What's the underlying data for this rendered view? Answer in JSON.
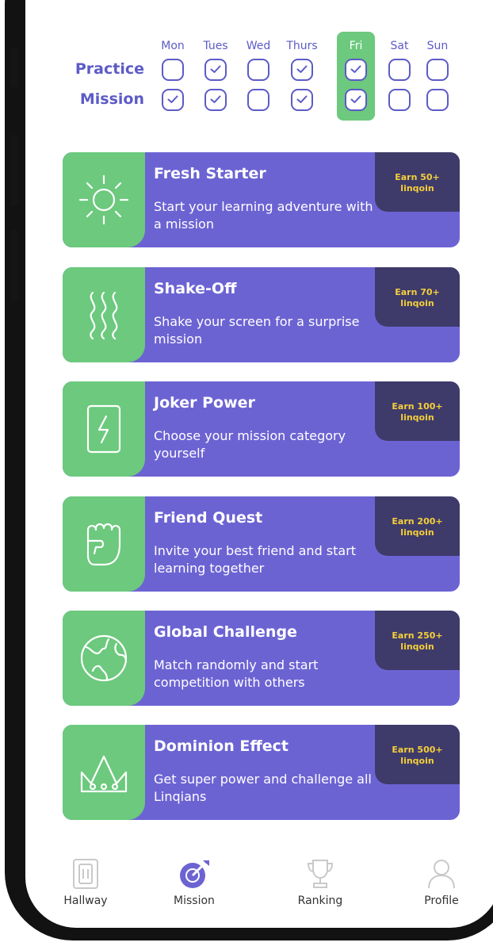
{
  "tracker": {
    "days": [
      "Mon",
      "Tues",
      "Wed",
      "Thurs",
      "Fri",
      "Sat",
      "Sun"
    ],
    "current_day": "Fri",
    "rows": [
      {
        "label": "Practice",
        "checked": [
          false,
          true,
          false,
          true,
          true,
          false,
          false
        ]
      },
      {
        "label": "Mission",
        "checked": [
          true,
          true,
          false,
          true,
          true,
          false,
          false
        ]
      }
    ]
  },
  "missions": [
    {
      "icon": "sun-icon",
      "title": "Fresh Starter",
      "description": "Start your learning adventure with a mission",
      "reward_line1": "Earn 50+",
      "reward_line2": "linqoin"
    },
    {
      "icon": "shake-waves-icon",
      "title": "Shake-Off",
      "description": "Shake your screen for a surprise mission",
      "reward_line1": "Earn 70+",
      "reward_line2": "linqoin"
    },
    {
      "icon": "joker-card-icon",
      "title": "Joker Power",
      "description": "Choose your mission category yourself",
      "reward_line1": "Earn 100+",
      "reward_line2": "linqoin"
    },
    {
      "icon": "fist-icon",
      "title": "Friend Quest",
      "description": "Invite your best friend and start learning together",
      "reward_line1": "Earn 200+",
      "reward_line2": "linqoin"
    },
    {
      "icon": "globe-icon",
      "title": "Global Challenge",
      "description": "Match randomly and start competition with others",
      "reward_line1": "Earn 250+",
      "reward_line2": "linqoin"
    },
    {
      "icon": "crown-icon",
      "title": "Dominion Effect",
      "description": "Get super power and challenge all Linqians",
      "reward_line1": "Earn 500+",
      "reward_line2": "linqoin"
    }
  ],
  "nav": [
    {
      "icon": "hallway-icon",
      "label": "Hallway",
      "active": false
    },
    {
      "icon": "target-dart-icon",
      "label": "Mission",
      "active": true
    },
    {
      "icon": "trophy-icon",
      "label": "Ranking",
      "active": false
    },
    {
      "icon": "person-icon",
      "label": "Profile",
      "active": false
    }
  ],
  "colors": {
    "primary": "#5c5bc7",
    "card": "#6c63d3",
    "green": "#6cc97d",
    "reward_bg": "#3e3b6a",
    "reward_text": "#f5cf3b"
  }
}
